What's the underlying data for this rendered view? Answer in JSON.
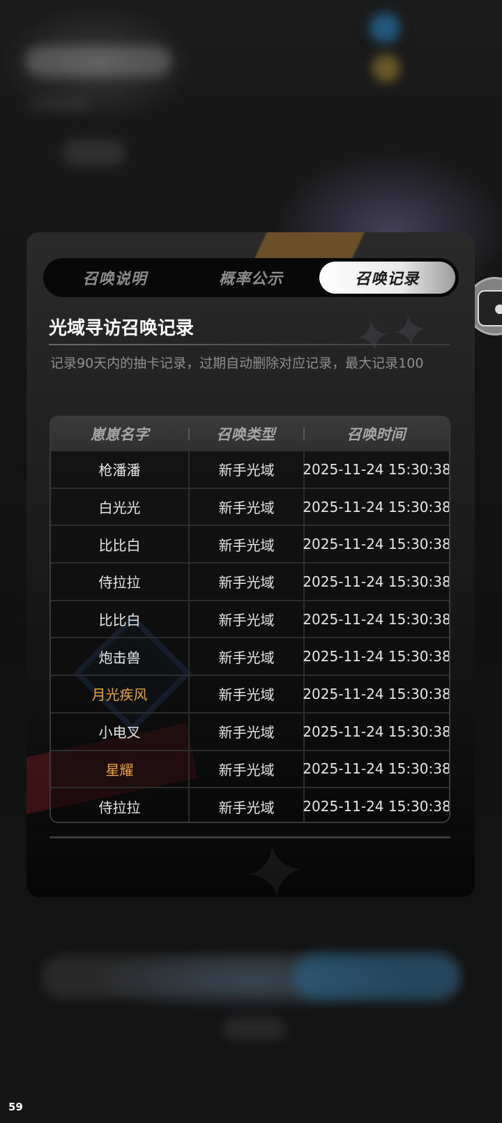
{
  "tabs": [
    {
      "label": "召唤说明",
      "active": false
    },
    {
      "label": "概率公示",
      "active": false
    },
    {
      "label": "召唤记录",
      "active": true
    }
  ],
  "record": {
    "title": "光域寻访召唤记录",
    "note": "记录90天内的抽卡记录，过期自动删除对应记录，最大记录100"
  },
  "table": {
    "headers": [
      "崽崽名字",
      "召唤类型",
      "召唤时间"
    ],
    "rows": [
      {
        "name": "枪潘潘",
        "type": "新手光域",
        "time": "2025-11-24 15:30:38",
        "highlight": false
      },
      {
        "name": "白光光",
        "type": "新手光域",
        "time": "2025-11-24 15:30:38",
        "highlight": false
      },
      {
        "name": "比比白",
        "type": "新手光域",
        "time": "2025-11-24 15:30:38",
        "highlight": false
      },
      {
        "name": "侍拉拉",
        "type": "新手光域",
        "time": "2025-11-24 15:30:38",
        "highlight": false
      },
      {
        "name": "比比白",
        "type": "新手光域",
        "time": "2025-11-24 15:30:38",
        "highlight": false
      },
      {
        "name": "炮击兽",
        "type": "新手光域",
        "time": "2025-11-24 15:30:38",
        "highlight": false
      },
      {
        "name": "月光疾风",
        "type": "新手光域",
        "time": "2025-11-24 15:30:38",
        "highlight": true
      },
      {
        "name": "小电叉",
        "type": "新手光域",
        "time": "2025-11-24 15:30:38",
        "highlight": false
      },
      {
        "name": "星耀",
        "type": "新手光域",
        "time": "2025-11-24 15:30:38",
        "highlight": true
      },
      {
        "name": "侍拉拉",
        "type": "新手光域",
        "time": "2025-11-24 15:30:38",
        "highlight": false
      }
    ]
  },
  "colors": {
    "highlight": "#e8a33a",
    "text": "#e6e6e6",
    "tab_active_bg": "#ffffff"
  },
  "fps_counter": "59",
  "side_button": {
    "icon": "chat-bubble-icon"
  }
}
